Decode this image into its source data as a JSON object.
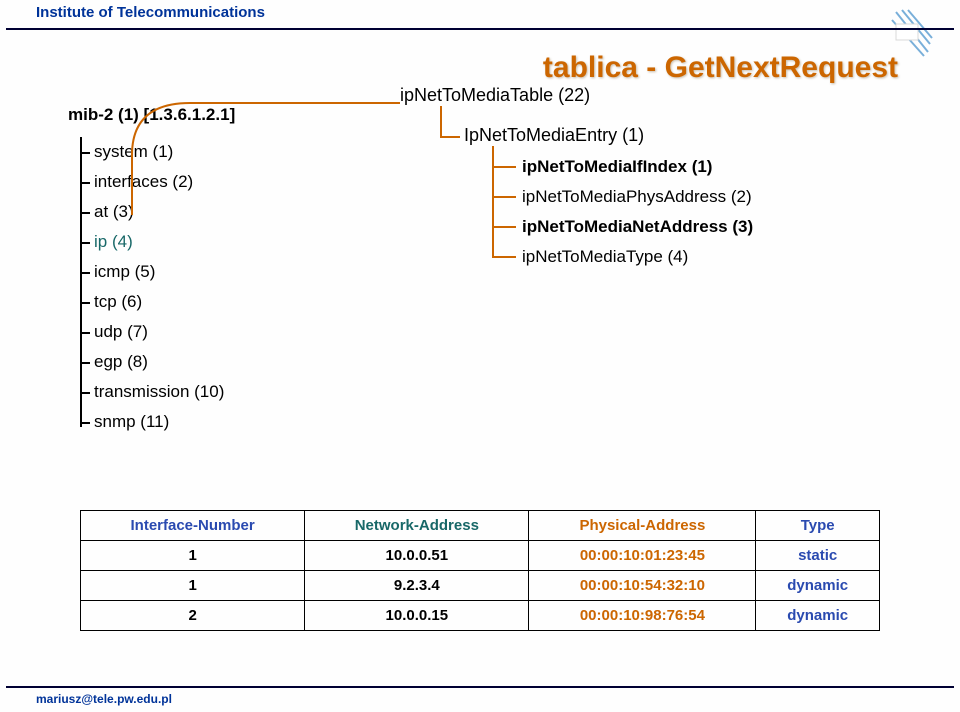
{
  "header": {
    "org": "Institute of Telecommunications"
  },
  "title": "tablica - GetNextRequest",
  "mib": {
    "root": "mib-2 (1) [1.3.6.1.2.1]",
    "items": [
      {
        "label": "system (1)",
        "cls": ""
      },
      {
        "label": "interfaces (2)",
        "cls": ""
      },
      {
        "label": "at (3)",
        "cls": ""
      },
      {
        "label": "ip (4)",
        "cls": "teal"
      },
      {
        "label": "icmp (5)",
        "cls": ""
      },
      {
        "label": "tcp (6)",
        "cls": ""
      },
      {
        "label": "udp (7)",
        "cls": ""
      },
      {
        "label": "egp (8)",
        "cls": ""
      },
      {
        "label": "transmission (10)",
        "cls": ""
      },
      {
        "label": "snmp (11)",
        "cls": ""
      }
    ]
  },
  "right": {
    "table_label": "ipNetToMediaTable (22)",
    "entry_label": "IpNetToMediaEntry (1)",
    "subs": [
      {
        "label": "ipNetToMediaIfIndex (1)",
        "bold": true
      },
      {
        "label": "ipNetToMediaPhysAddress (2)",
        "bold": false
      },
      {
        "label": "ipNetToMediaNetAddress (3)",
        "bold": true
      },
      {
        "label": "ipNetToMediaType (4)",
        "bold": false
      }
    ]
  },
  "table": {
    "headers": [
      "Interface-Number",
      "Network-Address",
      "Physical-Address",
      "Type"
    ],
    "rows": [
      [
        "1",
        "10.0.0.51",
        "00:00:10:01:23:45",
        "static"
      ],
      [
        "1",
        "9.2.3.4",
        "00:00:10:54:32:10",
        "dynamic"
      ],
      [
        "2",
        "10.0.0.15",
        "00:00:10:98:76:54",
        "dynamic"
      ]
    ]
  },
  "footer": {
    "email": "mariusz@tele.pw.edu.pl"
  }
}
